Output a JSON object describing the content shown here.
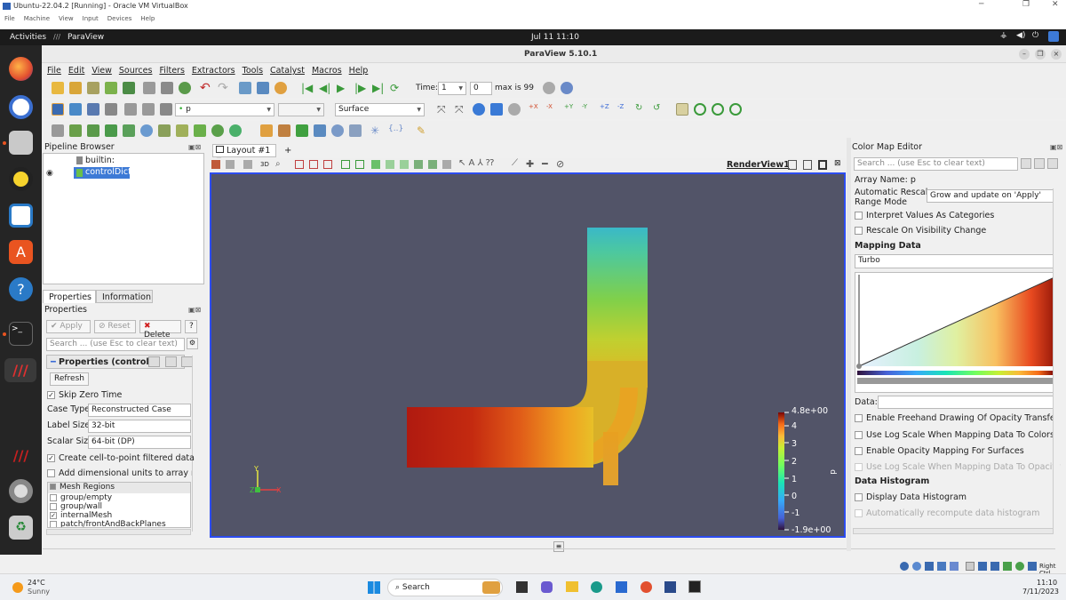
{
  "vbox": {
    "title": "Ubuntu-22.04.2 [Running] - Oracle VM VirtualBox",
    "menu": [
      "File",
      "Machine",
      "View",
      "Input",
      "Devices",
      "Help"
    ],
    "status_right": "Right Ctrl"
  },
  "gnome": {
    "activities": "Activities",
    "app": "ParaView",
    "clock": "Jul 11  11:10"
  },
  "pv": {
    "title": "ParaView 5.10.1",
    "menu": [
      "File",
      "Edit",
      "View",
      "Sources",
      "Filters",
      "Extractors",
      "Tools",
      "Catalyst",
      "Macros",
      "Help"
    ],
    "time_label": "Time:",
    "time_value": "1",
    "step_value": "0",
    "max_label": "max is 99",
    "array_value": "p",
    "representation": "Surface"
  },
  "pipeline": {
    "title": "Pipeline Browser",
    "root": "builtin:",
    "item": "controlDict"
  },
  "props": {
    "tab_properties": "Properties",
    "tab_information": "Information",
    "title": "Properties",
    "apply": "Apply",
    "reset": "Reset",
    "delete": "Delete",
    "help": "?",
    "search_placeholder": "Search ... (use Esc to clear text)",
    "section": "Properties (control",
    "refresh": "Refresh",
    "skip_zero": "Skip Zero Time",
    "case_type_label": "Case Type",
    "case_type_value": "Reconstructed Case",
    "label_size_label": "Label Size",
    "label_size_value": "32-bit",
    "scalar_size_label": "Scalar Size",
    "scalar_size_value": "64-bit (DP)",
    "create_cell": "Create cell-to-point filtered data",
    "add_dims": "Add dimensional units to array nam",
    "mesh_regions_header": "Mesh Regions",
    "mesh_regions": [
      "group/empty",
      "group/wall",
      "internalMesh",
      "patch/frontAndBackPlanes"
    ]
  },
  "layout": {
    "tab": "Layout #1",
    "add": "+",
    "view_name": "RenderView1",
    "btn_3d": "3D"
  },
  "colorbar": {
    "title": "p",
    "max_label": "4.8e+00",
    "min_label": "-1.9e+00",
    "ticks": [
      "4",
      "3",
      "2",
      "1",
      "0",
      "-1"
    ]
  },
  "axes": {
    "y": "Y",
    "z": "Z",
    "x": "X"
  },
  "cme": {
    "title": "Color Map Editor",
    "search_placeholder": "Search ... (use Esc to clear text)",
    "array_name": "Array Name: p",
    "rescale_label_1": "Automatic Rescale",
    "rescale_label_2": "Range Mode",
    "rescale_value": "Grow and update on 'Apply'",
    "interpret": "Interpret Values As Categories",
    "rescale_visibility": "Rescale On Visibility Change",
    "mapping_data": "Mapping Data",
    "preset": "Turbo",
    "data_label": "Data:",
    "freehand": "Enable Freehand Drawing Of Opacity Transfer Fun",
    "log_scale": "Use Log Scale When Mapping Data To Colors",
    "opacity_surfaces": "Enable Opacity Mapping For Surfaces",
    "log_opacity": "Use Log Scale When Mapping Data To Opacity",
    "histogram": "Data Histogram",
    "display_hist": "Display Data Histogram",
    "auto_hist": "Automatically recompute data histogram"
  },
  "taskbar": {
    "temp": "24°C",
    "weather": "Sunny",
    "search": "Search",
    "time": "11:10",
    "date": "7/11/2023"
  },
  "colors": {
    "accent": "#2c4cf0",
    "render_bg": "#525468",
    "selection": "#3d7ad6"
  }
}
